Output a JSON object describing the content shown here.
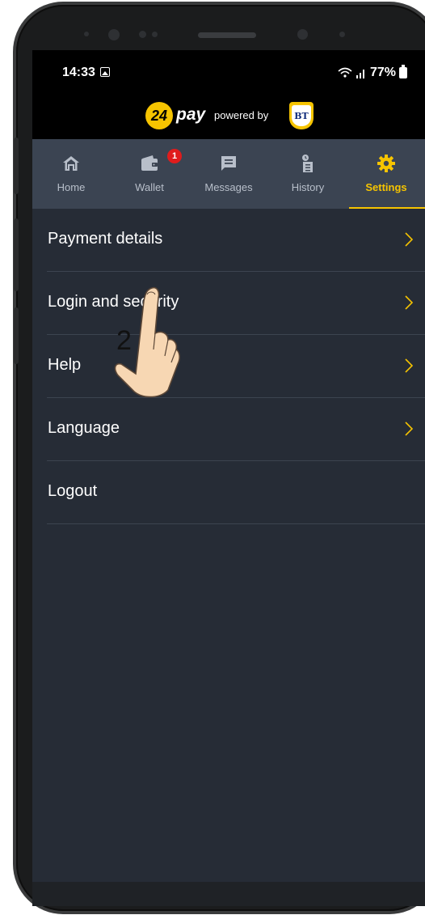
{
  "status_bar": {
    "time": "14:33",
    "battery": "77%",
    "icons": [
      "gallery-icon",
      "wifi-icon",
      "signal-icon",
      "battery-icon"
    ]
  },
  "brand": {
    "logo_number": "24",
    "logo_word": "pay",
    "powered_by": "powered by",
    "partner_logo": "BT"
  },
  "tabs": [
    {
      "label": "Home",
      "icon": "home-icon",
      "active": false
    },
    {
      "label": "Wallet",
      "icon": "wallet-icon",
      "active": false,
      "badge": "1"
    },
    {
      "label": "Messages",
      "icon": "message-icon",
      "active": false
    },
    {
      "label": "History",
      "icon": "history-icon",
      "active": false
    },
    {
      "label": "Settings",
      "icon": "gear-icon",
      "active": true
    }
  ],
  "menu": [
    {
      "label": "Payment details",
      "has_chevron": true
    },
    {
      "label": "Login and security",
      "has_chevron": true
    },
    {
      "label": "Help",
      "has_chevron": true
    },
    {
      "label": "Language",
      "has_chevron": true
    },
    {
      "label": "Logout",
      "has_chevron": false
    }
  ],
  "overlay": {
    "step_number": "2"
  },
  "colors": {
    "accent": "#f6c400",
    "background": "#262c36",
    "tabbar": "#3b4452",
    "badge": "#e01c1c"
  }
}
